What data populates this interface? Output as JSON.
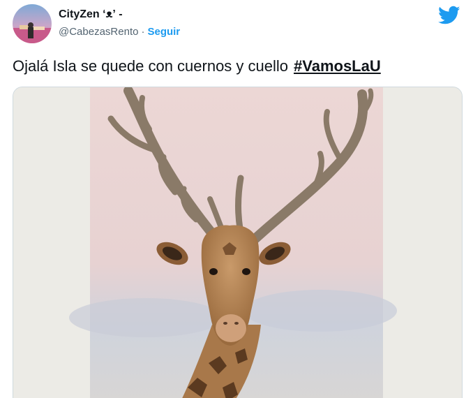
{
  "author": {
    "display_name": "CityZen ʻᴥʼ -",
    "handle": "@CabezasRento",
    "separator": "·",
    "follow_label": "Seguir"
  },
  "tweet": {
    "text": "Ojalá Isla se quede con cuernos y cuello",
    "hashtag": "#VamosLaU"
  },
  "icons": {
    "brand": "twitter-bird-icon",
    "brand_color": "#1d9bf0"
  },
  "colors": {
    "link": "#1d9bf0",
    "text": "#0f1419",
    "secondary": "#536471"
  }
}
